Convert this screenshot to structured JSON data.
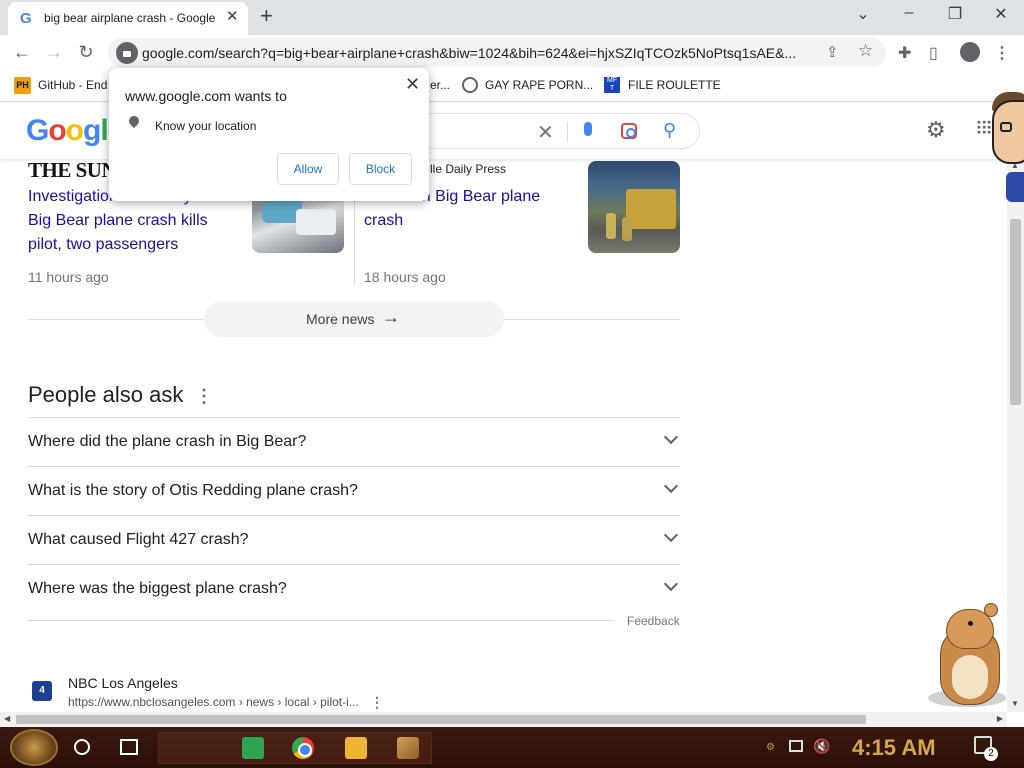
{
  "browser": {
    "tab_title": "big bear airplane crash - Google",
    "new_tab_symbol": "+",
    "url": "google.com/search?q=big+bear+airplane+crash&biw=1024&bih=624&ei=hjxSZIqTCOzk5NoPtsq1sAE&...",
    "bookmarks": [
      {
        "label": "GitHub - End"
      },
      {
        "label": "er..."
      },
      {
        "label": "GAY RAPE PORN..."
      },
      {
        "label": "FILE ROULETTE"
      }
    ]
  },
  "location_prompt": {
    "title": "www.google.com wants to",
    "permission": "Know your location",
    "allow_label": "Allow",
    "block_label": "Block"
  },
  "google": {
    "logo_text": "Google"
  },
  "news": [
    {
      "source": "THE SUN",
      "headline": "Investigation underway after Big Bear plane crash kills pilot, two passengers",
      "time": "11 hours ago"
    },
    {
      "source": "...lle Daily Press",
      "headline": "3 killed in Big Bear plane crash",
      "time": "18 hours ago"
    }
  ],
  "more_news_label": "More news",
  "people_also_ask": {
    "title": "People also ask",
    "questions": [
      "Where did the plane crash in Big Bear?",
      "What is the story of Otis Redding plane crash?",
      "What caused Flight 427 crash?",
      "Where was the biggest plane crash?"
    ],
    "feedback_label": "Feedback"
  },
  "result": {
    "icon_text": "4",
    "site_name": "NBC Los Angeles",
    "url": "https://www.nbclosangeles.com › news › local › pilot-i..."
  },
  "taskbar": {
    "clock": "4:15 AM",
    "notification_count": "2"
  }
}
